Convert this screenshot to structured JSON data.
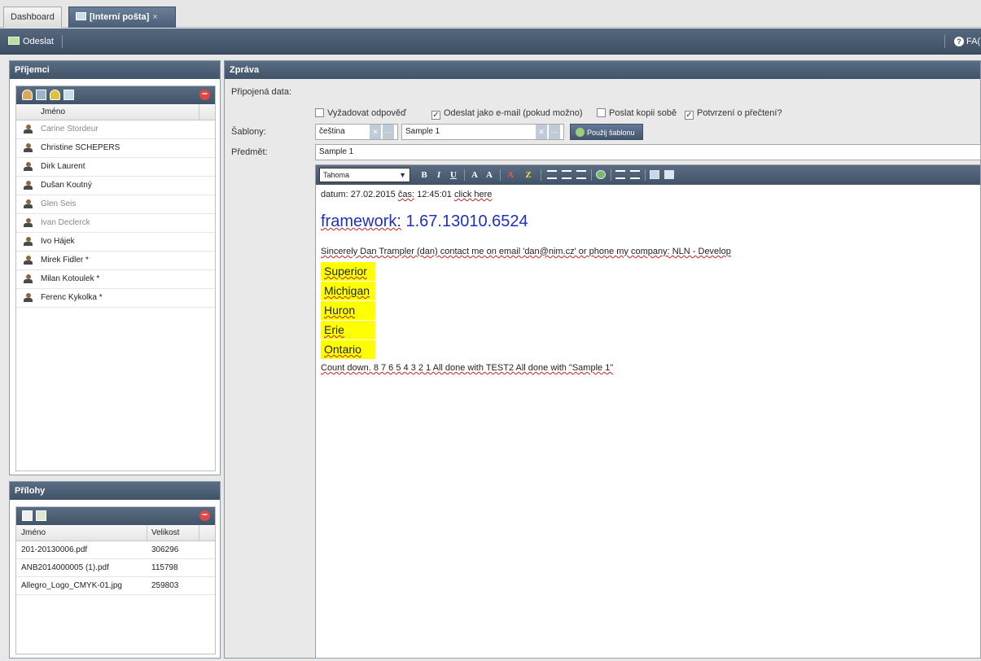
{
  "tabs": {
    "dashboard": "Dashboard",
    "mail": "[Interní pošta]",
    "close": "×"
  },
  "toolbar": {
    "send": "Odeslat",
    "faq": "FA("
  },
  "recipients": {
    "title": "Příjemci",
    "col_name": "Jméno",
    "items": [
      {
        "name": "Carine Stordeur",
        "dim": true
      },
      {
        "name": "Christine SCHEPERS",
        "dim": false
      },
      {
        "name": "Dirk Laurent",
        "dim": false
      },
      {
        "name": "Dušan Koutný",
        "dim": false
      },
      {
        "name": "Glen Seis",
        "dim": true
      },
      {
        "name": "Ivan Declerck",
        "dim": true
      },
      {
        "name": "Ivo Hájek",
        "dim": false
      },
      {
        "name": "Mirek Fidler *",
        "dim": false
      },
      {
        "name": "Milan Kotoulek *",
        "dim": false
      },
      {
        "name": "Ferenc Kykolka *",
        "dim": false
      }
    ]
  },
  "attachments": {
    "title": "Přílohy",
    "col_name": "Jméno",
    "col_size": "Velikost",
    "files": [
      {
        "name": "201-20130006.pdf",
        "size": "306296"
      },
      {
        "name": "ANB2014000005 (1).pdf",
        "size": "115798"
      },
      {
        "name": "Allegro_Logo_CMYK-01.jpg",
        "size": "259803"
      }
    ]
  },
  "message": {
    "title": "Zpráva",
    "attached_label": "Připojená data:",
    "options": [
      {
        "label": "Vyžadovat odpověď",
        "checked": false
      },
      {
        "label": "Odeslat jako e-mail (pokud možno)",
        "checked": true
      },
      {
        "label": "Poslat kopii sobě",
        "checked": false
      },
      {
        "label": "Potvrzení o přečtení?",
        "checked": true
      }
    ],
    "templates_label": "Šablony:",
    "language": "čeština",
    "template": "Sample 1",
    "apply_label": "Použij šablonu",
    "subject_label": "Předmět:",
    "subject": "Sample 1"
  },
  "editor": {
    "font": "Tahoma",
    "date_label": "datum:",
    "date": "27.02.2015",
    "time_label": "čas:",
    "time": "12:45:01",
    "link": "click here",
    "framework_label": "framework:",
    "framework_version": "1.67.13010.6524",
    "signature": "Sincerely Dan Trampler (dan) contact me on email 'dan@nim.cz' or phone my company: NLN - Develop",
    "lakes": [
      "Superior",
      "Michigan",
      "Huron",
      "Erie",
      "Ontario"
    ],
    "countdown": "Count down. 8 7 6 5 4 3 2 1 All done with TEST2 All done with \"Sample 1\""
  },
  "colors": {
    "header": "#4a5e78",
    "highlight": "#ffff00",
    "framework": "#2030c0",
    "delete": "#e04848"
  }
}
